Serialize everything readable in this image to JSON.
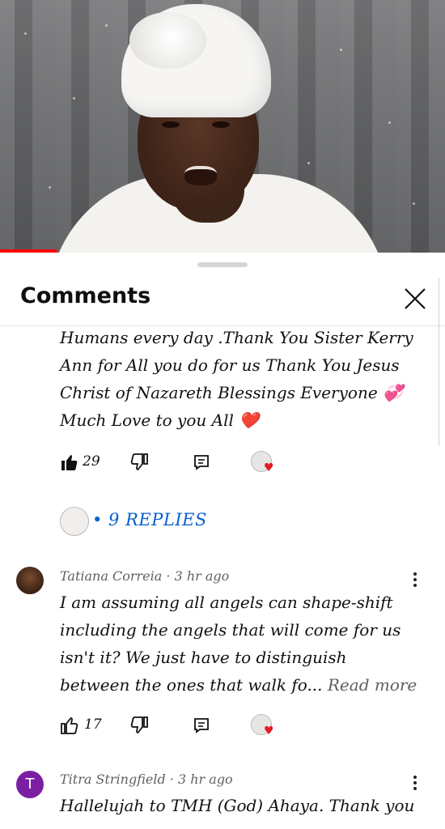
{
  "sheet": {
    "title": "Comments"
  },
  "comment1": {
    "lines": [
      "Humans every day .Thank You Sister Kerry",
      "Ann for All you do for us Thank You Jesus",
      "Christ of Nazareth Blessings Everyone 💞",
      "Much Love to you All ❤️"
    ],
    "likes": "29",
    "replies_label": "• 9 REPLIES"
  },
  "comment2": {
    "author": "Tatiana Correia",
    "time": "3 hr ago",
    "lines": [
      "I am assuming all angels can shape-shift",
      "including the angels that will come for us",
      "isn't it? We just have to distinguish",
      "between the ones that walk fo..."
    ],
    "read_more": "Read more",
    "likes": "17"
  },
  "comment3": {
    "author": "Titra Stringfield",
    "time": "3 hr ago",
    "avatar_letter": "T",
    "lines": [
      "Hallelujah to TMH (God) Ahaya. Thank you"
    ]
  },
  "colors": {
    "progress": "#ff0000",
    "link": "#065fd4",
    "avatar_t": "#7b1fa2",
    "heart": "#e21b23"
  },
  "icons": [
    "like-icon",
    "dislike-icon",
    "reply-icon",
    "close-icon",
    "more-vert-icon",
    "heart-icon"
  ]
}
